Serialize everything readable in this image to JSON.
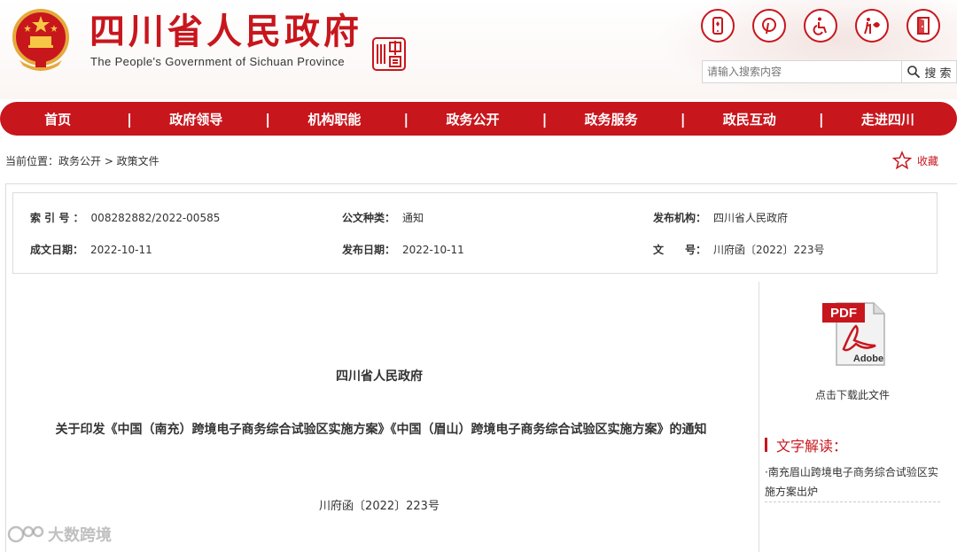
{
  "header": {
    "title_cn": "四川省人民政府",
    "title_en": "The People's Government of Sichuan Province",
    "seal_text": "四川中国",
    "icons": [
      "mobile-icon",
      "pinterest-icon",
      "accessibility-icon",
      "elderly-care-icon",
      "exit-door-icon"
    ]
  },
  "search": {
    "placeholder": "请输入搜索内容",
    "button_label": "搜 索"
  },
  "nav": {
    "items": [
      "首页",
      "政府领导",
      "机构职能",
      "政务公开",
      "政务服务",
      "政民互动",
      "走进四川"
    ],
    "separator": "|"
  },
  "breadcrumb": {
    "text": "当前位置：政务公开 > 政策文件"
  },
  "favorite": {
    "label": "收藏"
  },
  "meta": {
    "index_label": "索 引 号 ：",
    "index_value": "008282882/2022-00585",
    "type_label": "公文种类：",
    "type_value": "通知",
    "issuer_label": "发布机构：",
    "issuer_value": "四川省人民政府",
    "created_label": "成文日期：",
    "created_value": "2022-10-11",
    "published_label": "发布日期：",
    "published_value": "2022-10-11",
    "docno_label": "文　　号：",
    "docno_value": "川府函〔2022〕223号"
  },
  "document": {
    "issuer": "四川省人民政府",
    "title": "关于印发《中国（南充）跨境电子商务综合试验区实施方案》《中国（眉山）跨境电子商务综合试验区实施方案》的通知",
    "number": "川府函〔2022〕223号"
  },
  "sidebar": {
    "download_label": "点击下载此文件",
    "pdf_label": "PDF",
    "adobe_label": "Adobe",
    "interpretation_title": "文字解读：",
    "interpretation_link": "·南充眉山跨境电子商务综合试验区实施方案出炉"
  },
  "watermark": {
    "text": "大数跨境"
  },
  "colors": {
    "brand_red": "#c8161d",
    "border": "#dcdcdc"
  }
}
